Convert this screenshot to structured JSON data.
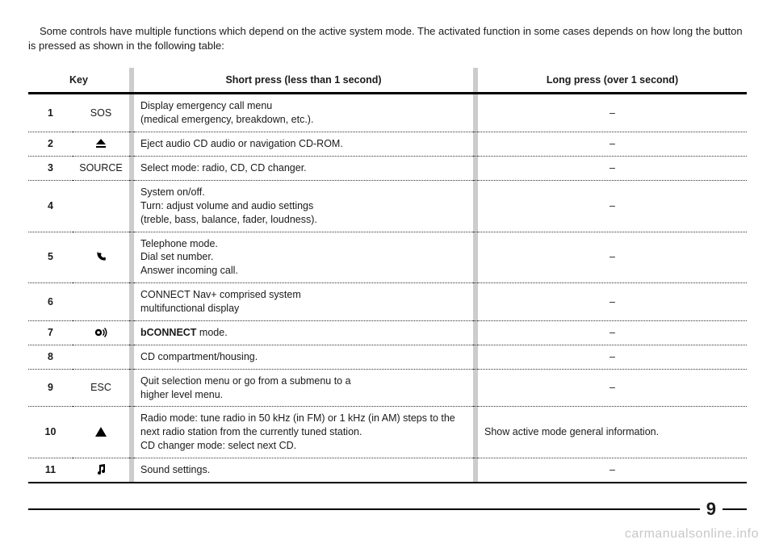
{
  "intro": "Some controls have multiple functions which depend on the active system mode. The activated function in some cases depends on how long the button is pressed as shown in the following table:",
  "headers": {
    "key": "Key",
    "short": "Short press (less than 1 second)",
    "long": "Long press (over 1 second)"
  },
  "rows": [
    {
      "num": "1",
      "label": "SOS",
      "icon": "",
      "short": "Display emergency call menu\n(medical emergency, breakdown, etc.).",
      "long": "–"
    },
    {
      "num": "2",
      "label": "",
      "icon": "eject",
      "short": "Eject audio CD audio or navigation CD-ROM.",
      "long": "–"
    },
    {
      "num": "3",
      "label": "SOURCE",
      "icon": "",
      "short": "Select mode: radio, CD, CD changer.",
      "long": "–"
    },
    {
      "num": "4",
      "label": "",
      "icon": "",
      "short": "System on/off.\nTurn: adjust volume and audio settings\n(treble, bass, balance, fader, loudness).",
      "long": "–"
    },
    {
      "num": "5",
      "label": "",
      "icon": "phone",
      "short": "Telephone mode.\nDial set number.\nAnswer incoming call.",
      "long": "–"
    },
    {
      "num": "6",
      "label": "",
      "icon": "",
      "short": "CONNECT Nav+ comprised system\nmultifunctional display",
      "long": "–"
    },
    {
      "num": "7",
      "label": "",
      "icon": "speaker",
      "short_bold": "bCONNECT",
      "short_rest": " mode.",
      "long": "–"
    },
    {
      "num": "8",
      "label": "",
      "icon": "",
      "short": "CD compartment/housing.",
      "long": "–"
    },
    {
      "num": "9",
      "label": "ESC",
      "icon": "",
      "short": "Quit selection menu or go from a submenu to a\nhigher level menu.",
      "long": "–"
    },
    {
      "num": "10",
      "label": "",
      "icon": "triangle-up",
      "short": "Radio mode: tune radio in 50 kHz (in FM) or 1 kHz (in AM) steps to the next radio station from the currently tuned station.\nCD changer mode: select next CD.",
      "long": "Show active mode general information."
    },
    {
      "num": "11",
      "label": "",
      "icon": "note",
      "short": "Sound settings.",
      "long": "–"
    }
  ],
  "page_number": "9",
  "watermark": "carmanualsonline.info"
}
